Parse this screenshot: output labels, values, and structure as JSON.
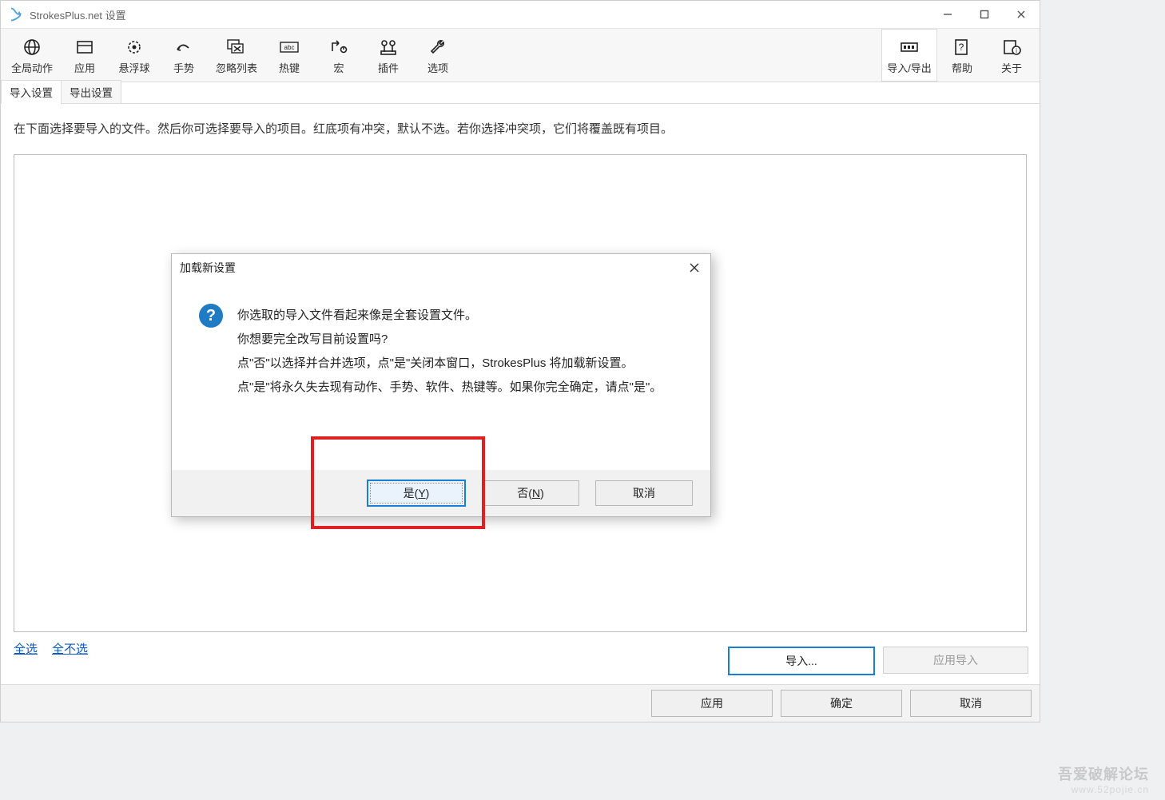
{
  "window": {
    "title": "StrokesPlus.net 设置"
  },
  "wincontrols": {
    "min": "—",
    "max": "□",
    "close": "✕"
  },
  "toolbar": [
    {
      "id": "global",
      "label": "全局动作"
    },
    {
      "id": "apps",
      "label": "应用"
    },
    {
      "id": "float",
      "label": "悬浮球"
    },
    {
      "id": "gesture",
      "label": "手势"
    },
    {
      "id": "ignore",
      "label": "忽略列表"
    },
    {
      "id": "hotkey",
      "label": "热键"
    },
    {
      "id": "macro",
      "label": "宏"
    },
    {
      "id": "plugin",
      "label": "插件"
    },
    {
      "id": "options",
      "label": "选项"
    }
  ],
  "toolbar_right": [
    {
      "id": "importexport",
      "label": "导入/导出"
    },
    {
      "id": "help",
      "label": "帮助"
    },
    {
      "id": "about",
      "label": "关于"
    }
  ],
  "subtabs": {
    "active": "导入设置",
    "inactive": "导出设置"
  },
  "description": "在下面选择要导入的文件。然后你可选择要导入的项目。红底项有冲突，默认不选。若你选择冲突项，它们将覆盖既有项目。",
  "links": {
    "select_all": "全选",
    "select_none": "全不选"
  },
  "buttons": {
    "import": "导入...",
    "apply_import": "应用导入",
    "apply": "应用",
    "ok": "确定",
    "cancel": "取消"
  },
  "modal": {
    "title": "加载新设置",
    "line1": "你选取的导入文件看起来像是全套设置文件。",
    "line2": "你想要完全改写目前设置吗?",
    "line3": "点\"否\"以选择并合并选项，点\"是\"关闭本窗口，StrokesPlus 将加载新设置。",
    "line4": "点\"是\"将永久失去现有动作、手势、软件、热键等。如果你完全确定，请点\"是\"。",
    "yes_pre": "是(",
    "yes_u": "Y",
    "yes_post": ")",
    "no_pre": "否(",
    "no_u": "N",
    "no_post": ")",
    "cancel": "取消"
  },
  "watermark": {
    "main": "吾爱破解论坛",
    "sub": "www.52pojie.cn"
  }
}
